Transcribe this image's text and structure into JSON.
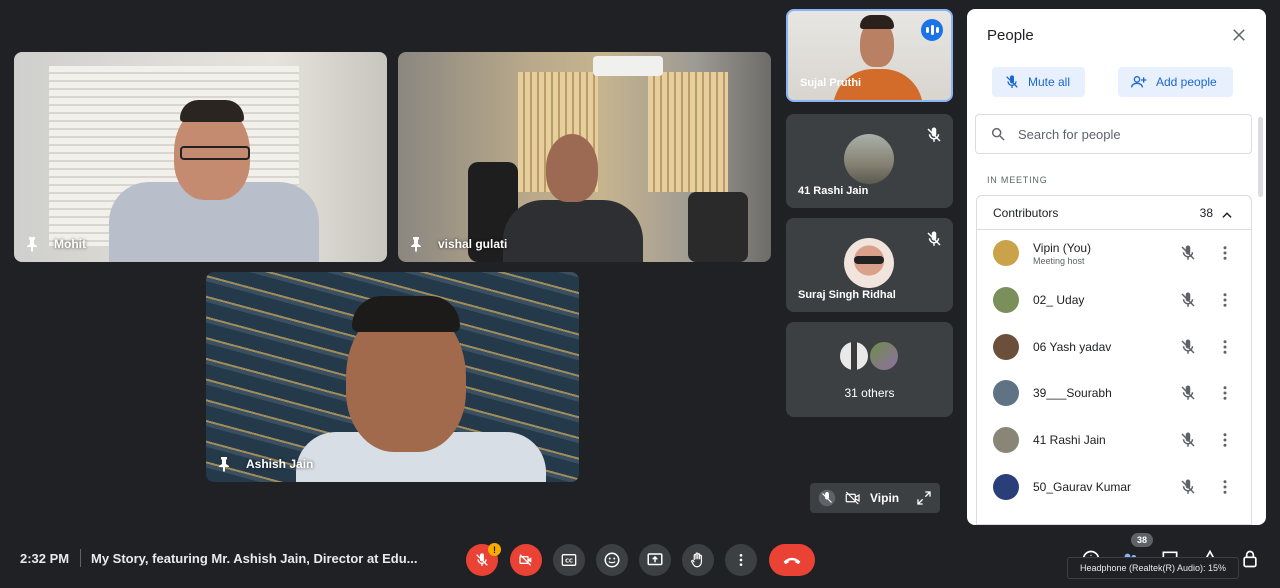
{
  "tiles": {
    "mohit": {
      "name": "Mohit"
    },
    "vishal": {
      "name": "vishal gulati"
    },
    "ashish": {
      "name": "Ashish Jain"
    }
  },
  "side": {
    "sujal": {
      "name": "Sujal Pruthi"
    },
    "rashi": {
      "name": "41 Rashi Jain"
    },
    "suraj": {
      "name": "Suraj Singh Ridhal"
    },
    "others": {
      "label": "31 others"
    }
  },
  "self_preview": {
    "name": "Vipin"
  },
  "panel": {
    "title": "People",
    "mute_all": "Mute all",
    "add_people": "Add people",
    "search_placeholder": "Search for people",
    "section_label": "IN MEETING",
    "contributors_label": "Contributors",
    "contributors_count": "38",
    "participants": [
      {
        "name": "Vipin (You)",
        "sub": "Meeting host",
        "color": "#c9a24a"
      },
      {
        "name": "02_ Uday",
        "sub": "",
        "color": "#7b8f5a"
      },
      {
        "name": "06 Yash yadav",
        "sub": "",
        "color": "#6b4f3a"
      },
      {
        "name": "39___Sourabh",
        "sub": "",
        "color": "#5f7385"
      },
      {
        "name": "41 Rashi Jain",
        "sub": "",
        "color": "#8a8677"
      },
      {
        "name": "50_Gaurav Kumar",
        "sub": "",
        "color": "#2a3f7a"
      }
    ]
  },
  "bottom": {
    "time": "2:32 PM",
    "meeting_title": "My Story, featuring Mr. Ashish Jain, Director at Edu...",
    "warning_badge": "!",
    "people_count": "38",
    "tooltip": "Headphone (Realtek(R) Audio): 15%"
  },
  "colors": {
    "background": "#202124",
    "accent": "#1a73e8",
    "danger": "#ea4335"
  }
}
